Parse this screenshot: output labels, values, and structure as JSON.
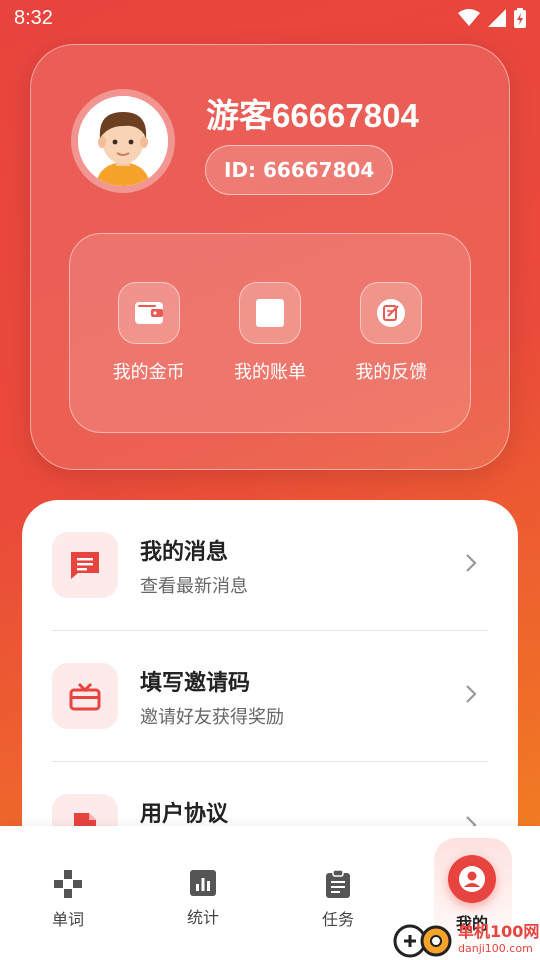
{
  "status": {
    "time": "8:32"
  },
  "profile": {
    "username": "游客66667804",
    "id_label": "ID: 66667804"
  },
  "quick_actions": [
    {
      "label": "我的金币",
      "icon": "wallet-icon"
    },
    {
      "label": "我的账单",
      "icon": "bill-icon"
    },
    {
      "label": "我的反馈",
      "icon": "feedback-icon"
    }
  ],
  "menu": [
    {
      "title": "我的消息",
      "subtitle": "查看最新消息",
      "icon": "message-icon"
    },
    {
      "title": "填写邀请码",
      "subtitle": "邀请好友获得奖励",
      "icon": "gift-icon"
    },
    {
      "title": "用户协议",
      "subtitle": "",
      "icon": "document-icon"
    }
  ],
  "nav": {
    "items": [
      {
        "label": "单词",
        "icon": "gamepad-icon"
      },
      {
        "label": "统计",
        "icon": "chart-icon"
      },
      {
        "label": "任务",
        "icon": "clipboard-icon"
      },
      {
        "label": "我的",
        "icon": "user-icon"
      }
    ],
    "active": "我的"
  },
  "watermark": {
    "name": "单机100网",
    "url": "danji100.com"
  },
  "colors": {
    "accent": "#e8443f",
    "accent_light": "#fdeaea"
  }
}
